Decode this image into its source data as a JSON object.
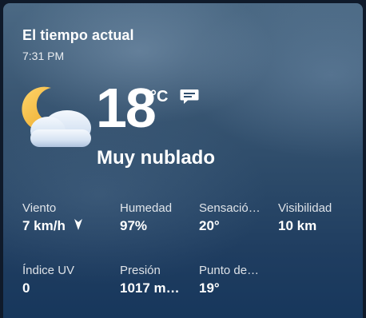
{
  "header": {
    "title": "El tiempo actual",
    "time": "7:31 PM"
  },
  "current": {
    "temperature": "18",
    "unit": "°C",
    "condition": "Muy nublado",
    "icon": "partly-cloudy-night-icon",
    "feedback_icon": "feedback-icon"
  },
  "stats": [
    {
      "label": "Viento",
      "value": "7 km/h"
    },
    {
      "label": "Humedad",
      "value": "97%"
    },
    {
      "label": "Sensació…",
      "value": "20°"
    },
    {
      "label": "Visibilidad",
      "value": "10 km"
    },
    {
      "label": "Índice UV",
      "value": "0"
    },
    {
      "label": "Presión",
      "value": "1017 m…"
    },
    {
      "label": "Punto de…",
      "value": "19°"
    }
  ],
  "colors": {
    "background_top": "#4b6984",
    "background_bottom": "#17375c",
    "moon": "#f2b63a",
    "cloud": "#dce8f7",
    "text": "#ffffff"
  }
}
